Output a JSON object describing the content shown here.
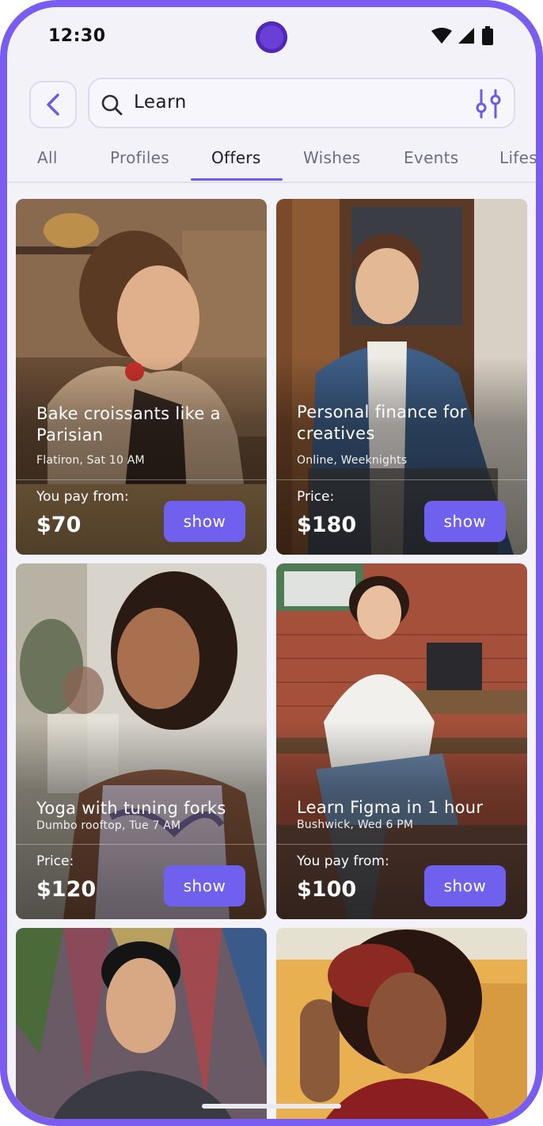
{
  "status_bar": {
    "time": "12:30"
  },
  "search": {
    "query": "Learn"
  },
  "tabs": [
    {
      "label": "All"
    },
    {
      "label": "Profiles"
    },
    {
      "label": "Offers"
    },
    {
      "label": "Wishes"
    },
    {
      "label": "Events"
    },
    {
      "label": "Lifes"
    }
  ],
  "active_tab": "Offers",
  "cards": [
    {
      "title": "Bake croissants like a Parisian",
      "subtitle": "Flatiron, Sat 10 AM",
      "price_label": "You pay from:",
      "price": "$70",
      "button": "show"
    },
    {
      "title": "Personal finance for creatives",
      "subtitle": "Online, Weeknights",
      "price_label": "Price:",
      "price": "$180",
      "button": "show"
    },
    {
      "title": "Yoga with tuning forks",
      "subtitle": "Dumbo rooftop, Tue 7 AM",
      "price_label": "Price:",
      "price": "$120",
      "button": "show"
    },
    {
      "title": "Learn Figma in 1 hour",
      "subtitle": "Bushwick, Wed 6 PM",
      "price_label": "You pay from:",
      "price": "$100",
      "button": "show"
    }
  ],
  "colors": {
    "accent": "#7060ee",
    "frame": "#7b5cf0",
    "background": "#f3f2f9"
  }
}
